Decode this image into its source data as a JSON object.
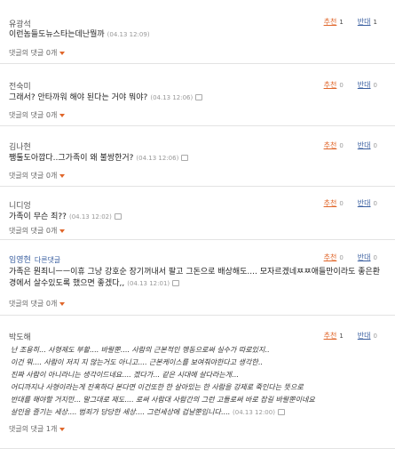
{
  "comments": [
    {
      "author": "유광석",
      "text": "이런놈들도뉴스타는데난뭘까",
      "date": "(04.13 12:09)",
      "up_label": "추천",
      "up": "1",
      "down_label": "반대",
      "down": "1",
      "replies": "댓글의 댓글 0개"
    },
    {
      "author": "전숙미",
      "text": "그래서? 안타까워 해야 된다는 거야 뭐야?",
      "date": "(04.13 12:06)",
      "up_label": "추천",
      "up": "0",
      "down_label": "반대",
      "down": "0",
      "replies": "댓글의 댓글 0개"
    },
    {
      "author": "김나현",
      "text": "쨍툴도아깝다..그가족이 왜 불쌍한거?",
      "date": "(04.13 12:06)",
      "up_label": "추천",
      "up": "0",
      "down_label": "반대",
      "down": "0",
      "replies": "댓글의 댓글 0개"
    },
    {
      "author": "니디엉",
      "text": "가족이 무슨 죄??",
      "date": "(04.13 12:02)",
      "up_label": "추천",
      "up": "0",
      "down_label": "반대",
      "down": "0",
      "replies": "댓글의 댓글 0개"
    },
    {
      "author": "임영현",
      "tag": "다른댓글",
      "text": "가족은 뭔죄니ㅡㅡ이휴 그냥 강호순 장기꺼내서 팔고 그돈으로 배상해도.... 모자르겠네ㅉㅉ애들만이라도 좋은환경에서 살수있도록 했으면 좋겠다,,",
      "date": "(04.13 12:01)",
      "up_label": "추천",
      "up": "0",
      "down_label": "반대",
      "down": "0",
      "replies": "댓글의 댓글 0개"
    },
    {
      "author": "박도해",
      "lines": [
        "난 조용히... 사형제도 부활.... 바랄뿐.... 사람의 근본적인 행동으로써 실수가 따로있지..",
        "이건 뭐.... 사람이 저지 지 않는거도 아니고.... 근본케이스를 보여줘야한다고 생각한..",
        "진짜 사람이 아니라니는 생각이드네요.... 겠다가... 같은 시대에 살다라는게...",
        "어디까지나 사형이라는게 잔혹하다 본다면 이건또한 한 살아있는 한 사람을 강제로 죽인다는 뜻으로",
        "반대를 해야할 거지만... 말그대로 제도.... 로써 사람대 사람간의 그런 고들로써 바로 잡길 바랄뿐이네요",
        "살인을 즐기는 세상.... 범죄가 당당한 세상.... 그런세상에 겁날뿐입니다...."
      ],
      "date": "(04.13 12:00)",
      "up_label": "추천",
      "up": "1",
      "down_label": "반대",
      "down": "0",
      "replies": "댓글의 댓글 1개"
    }
  ]
}
